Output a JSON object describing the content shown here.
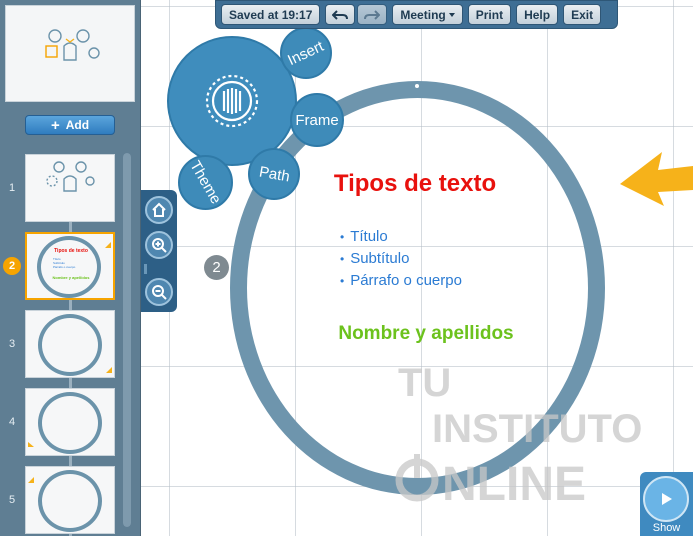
{
  "toolbar": {
    "saved_status": "Saved at 19:17",
    "meeting_label": "Meeting",
    "print_label": "Print",
    "help_label": "Help",
    "exit_label": "Exit"
  },
  "sidebar": {
    "add_label": "Add",
    "path_items": [
      {
        "number": "1"
      },
      {
        "number": "2"
      },
      {
        "number": "3"
      },
      {
        "number": "4"
      },
      {
        "number": "5"
      }
    ],
    "selected_thumb": {
      "title": "Tipos de texto",
      "bullets": [
        "Título",
        "Subtítulo",
        "Párrafo o cuerpo"
      ],
      "name": "Nombre y apellidos"
    }
  },
  "bubble_menu": {
    "insert_label": "Insert",
    "frame_label": "Frame",
    "path_label": "Path",
    "theme_label": "Theme"
  },
  "slide": {
    "title": "Tipos de texto",
    "bullets": [
      "Título",
      "Subtítulo",
      "Párrafo o cuerpo"
    ],
    "name": "Nombre y apellidos",
    "step": "2"
  },
  "watermark": {
    "line1": "TU",
    "line2": "INSTITUTO",
    "line3": "NLINE"
  },
  "show": {
    "label": "Show"
  },
  "colors": {
    "title": "#e8110d",
    "bullets": "#2b7bd3",
    "name": "#6cc21d",
    "accent": "#f6a400",
    "panel": "#5f7e93"
  }
}
